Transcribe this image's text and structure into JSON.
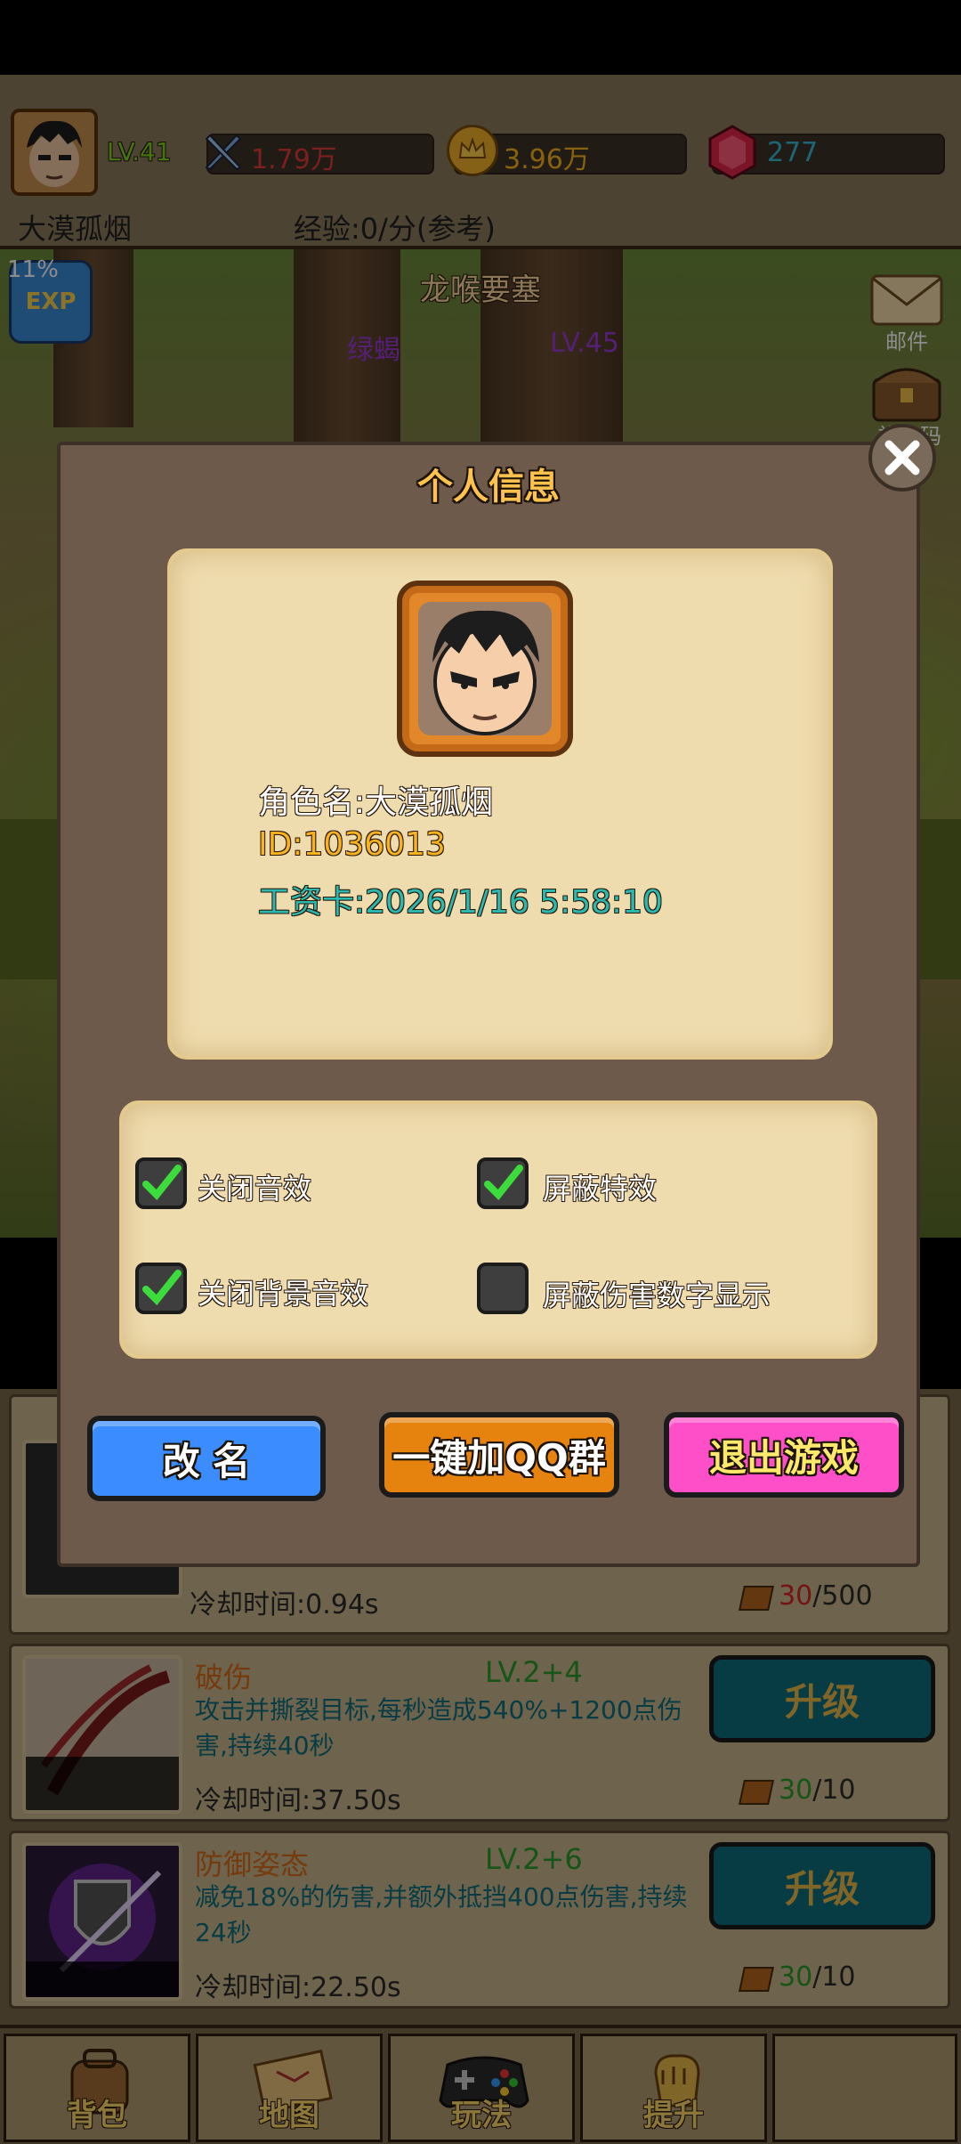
{
  "topbar": {
    "level": "LV.41",
    "power": "1.79万",
    "gold": "3.96万",
    "gems": "277",
    "player_name": "大漠孤烟",
    "exp_rate": "经验:0/分(参考)"
  },
  "scene": {
    "location": "龙喉要塞",
    "enemy_name": "绿蝎",
    "enemy_level": "LV.45",
    "exp_badge": "EXP",
    "exp_percent": "11%",
    "side_mail": "邮件",
    "side_gift": "礼包码"
  },
  "dialog": {
    "title": "个人信息",
    "role_name": "角色名:大漠孤烟",
    "id": "ID:1036013",
    "salary_card": "工资卡:2026/1/16 5:58:10",
    "options": [
      {
        "label": "关闭音效",
        "checked": true
      },
      {
        "label": "屏蔽特效",
        "checked": true
      },
      {
        "label": "关闭背景音效",
        "checked": true
      },
      {
        "label": "屏蔽伤害数字显示",
        "checked": false
      }
    ],
    "rename_label": "改 名",
    "join_qq_label": "一键加QQ群",
    "exit_label": "退出游戏"
  },
  "skills": [
    {
      "cooldown": "冷却时间:0.94s",
      "book_have": "30",
      "book_need": "/500"
    },
    {
      "name": "破伤",
      "level": "LV.2+4",
      "desc": "攻击并撕裂目标,每秒造成540%+1200点伤害,持续40秒",
      "cooldown": "冷却时间:37.50s",
      "book_have": "30",
      "book_need": "/10",
      "upgrade": "升级"
    },
    {
      "name": "防御姿态",
      "level": "LV.2+6",
      "desc": "减免18%的伤害,并额外抵挡400点伤害,持续24秒",
      "cooldown": "冷却时间:22.50s",
      "book_have": "30",
      "book_need": "/10",
      "upgrade": "升级"
    }
  ],
  "nav": [
    "背包",
    "地图",
    "玩法",
    "提升"
  ],
  "colors": {
    "rename": "#3b8cff",
    "join_qq": "#e6830f",
    "exit": "#ff4fc8",
    "accent_gold": "#ffc34d"
  }
}
